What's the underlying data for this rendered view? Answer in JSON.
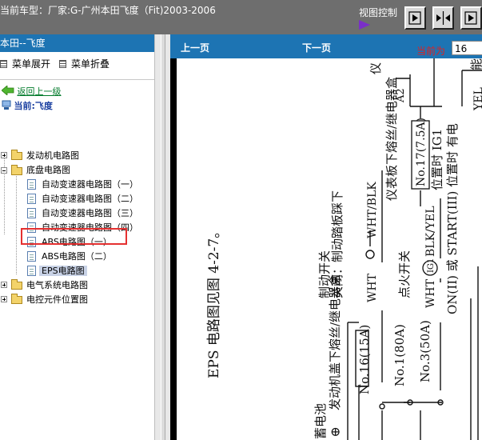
{
  "header": {
    "car_title": "当前车型：厂家:G-广州本田飞度（Fit)2003-2006",
    "view_control_label": "视图控制",
    "view_buttons": [
      "play-right-icon",
      "split-arrows-icon",
      "play-right-icon"
    ]
  },
  "sidebar": {
    "title": "本田--飞度",
    "expand_menu": "菜单展开",
    "collapse_menu": "菜单折叠",
    "back_link": "返回上一级",
    "current_label": "当前:飞度",
    "tree": [
      {
        "label": "发动机电路图",
        "type": "folder",
        "state": "collapsed"
      },
      {
        "label": "底盘电路图",
        "type": "folder",
        "state": "expanded",
        "children": [
          {
            "label": "自动变速器电路图（一）"
          },
          {
            "label": "自动变速器电路图（二）"
          },
          {
            "label": "自动变速器电路图（三）"
          },
          {
            "label": "自动变速器电路图（四）"
          },
          {
            "label": "ABS电路图（一）"
          },
          {
            "label": "ABS电路图（二）"
          },
          {
            "label": "EPS电路图",
            "selected": true
          }
        ]
      },
      {
        "label": "电气系统电路图",
        "type": "folder",
        "state": "collapsed"
      },
      {
        "label": "电控元件位置图",
        "type": "folder",
        "state": "collapsed"
      }
    ]
  },
  "toolbar": {
    "prev_page": "上一页",
    "next_page": "下一页",
    "current_page_label": "当前为",
    "current_page": "16"
  },
  "diagram": {
    "caption": "EPS 电路图见图 4-2-7。",
    "labels": {
      "battery": "蓄电池",
      "engine_fuse_box": "发动机盖下熔丝/继电器盒",
      "fuse_no16": "No.16(15A)",
      "fuse_no1": "No.1(80A)",
      "fuse_no3": "No.3(50A)",
      "brake_switch_title": "制动开关",
      "brake_switch_desc": "关闭：制动踏板踩下",
      "wire_wht": "WHT",
      "wire_wht_blk": "WHT/BLK",
      "dash_fuse_box": "仪表板下熔丝/继电器盒",
      "fuse_no17": "No.17(7.5A)",
      "ig1_position": "位置时 IG1",
      "ignition_switch": "点火开关",
      "ig_label": "IG1",
      "wire_blk_yel": "BLK/YEL",
      "on_start": "ON(II) 或 START(III) 位置时 有电",
      "connector_a2": "A2",
      "instrument_label": "仪",
      "wire_yel": "YEL",
      "partial_label": "能"
    }
  }
}
